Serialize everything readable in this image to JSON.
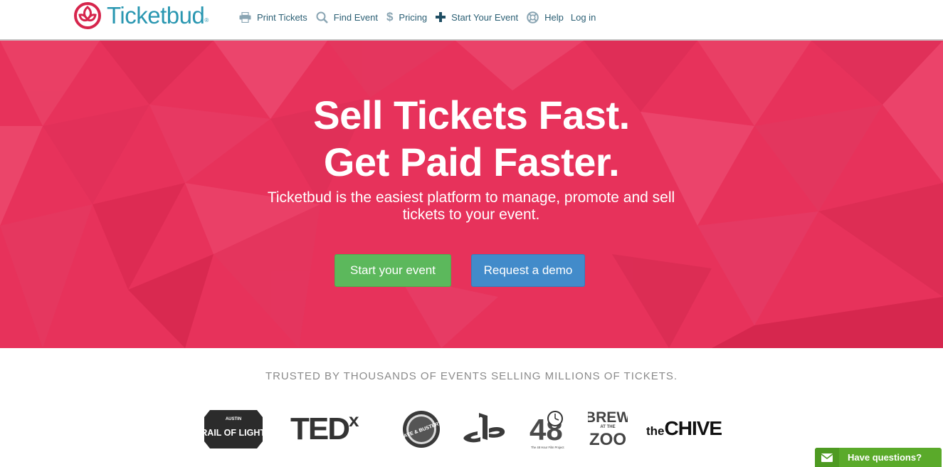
{
  "brand": {
    "name": "Ticketbud",
    "reg": "®",
    "color": "#2a97b1",
    "mark_color": "#d6254c"
  },
  "nav": {
    "items": [
      {
        "label": "Print Tickets",
        "icon": "printer-icon"
      },
      {
        "label": "Find Event",
        "icon": "search-icon"
      },
      {
        "label": "Pricing",
        "icon": "dollar-icon"
      },
      {
        "label": "Start Your Event",
        "icon": "plus-icon"
      },
      {
        "label": "Help",
        "icon": "lifebuoy-icon"
      },
      {
        "label": "Log in"
      }
    ]
  },
  "hero": {
    "headline_1": "Sell Tickets Fast.",
    "headline_2": "Get Paid Faster.",
    "subtitle": "Ticketbud is the easiest platform to manage, promote and sell tickets to your event.",
    "primary_button": "Start your event",
    "secondary_button": "Request a demo",
    "bg_color": "#e7325b"
  },
  "trusted": {
    "text": "TRUSTED BY THOUSANDS OF EVENTS SELLING MILLIONS OF TICKETS.",
    "logos": [
      {
        "name": "Austin Trail of Lights",
        "text_top": "AUSTIN",
        "text_main": "TRAIL OF LIGHTS"
      },
      {
        "name": "TEDx",
        "text_main": "TED",
        "text_sup": "x"
      },
      {
        "name": "Dave & Buster's",
        "text_main": "DAVE & BUSTER'S"
      },
      {
        "name": "PlayStation"
      },
      {
        "name": "48 Hour Film Project",
        "text_main": "48",
        "text_small": "The 48 Hour Film Project"
      },
      {
        "name": "Brew at the Zoo",
        "text_top": "BREW",
        "text_mid": "AT THE",
        "text_main": "ZOO"
      },
      {
        "name": "theCHIVE",
        "text_small": "the",
        "text_main": "CHIVE"
      }
    ]
  },
  "chat": {
    "label": "Have questions?",
    "icon": "envelope-icon",
    "color": "#5aaa2a"
  }
}
